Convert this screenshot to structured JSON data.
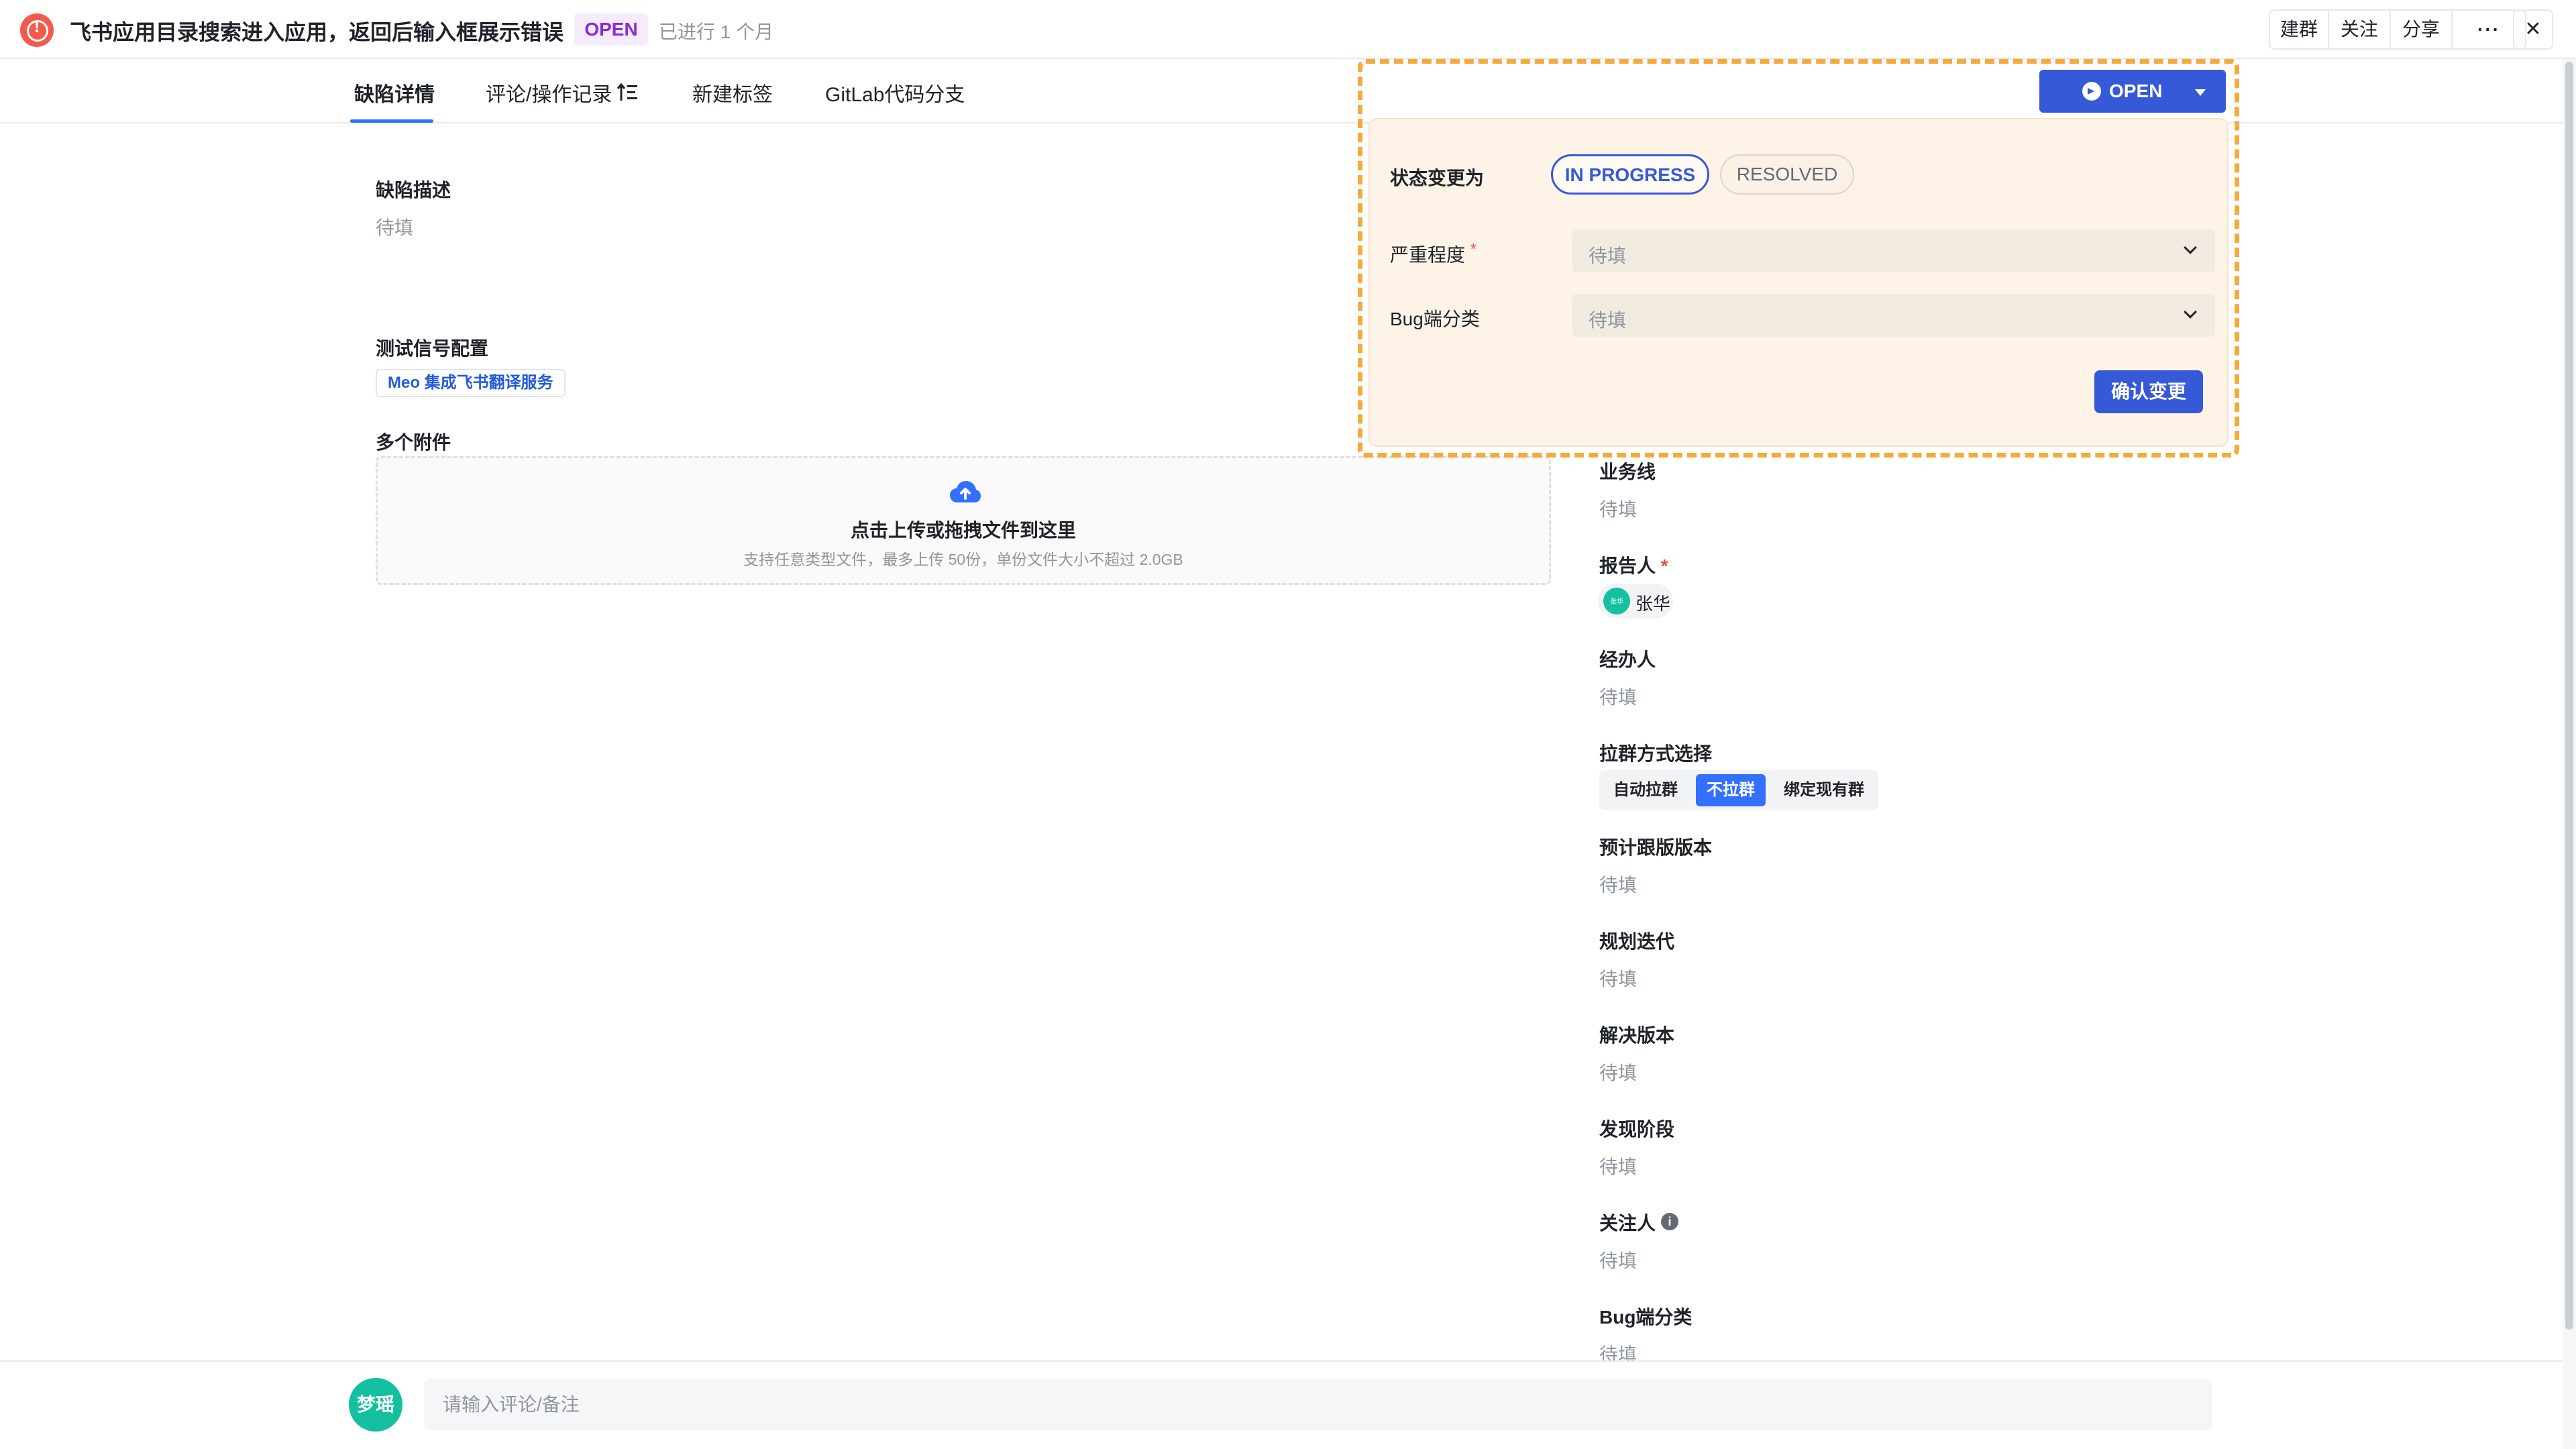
{
  "header": {
    "title": "飞书应用目录搜索进入应用，返回后输入框展示错误",
    "status_badge": "OPEN",
    "duration": "已进行 1 个月",
    "actions": [
      "建群",
      "关注",
      "分享",
      "···"
    ],
    "close": "✕"
  },
  "tabs": [
    {
      "label": "缺陷详情",
      "active": true
    },
    {
      "label": "评论/操作记录",
      "active": false
    },
    {
      "label": "新建标签",
      "active": false
    },
    {
      "label": "GitLab代码分支",
      "active": false
    }
  ],
  "left": {
    "description_label": "缺陷描述",
    "description_value": "待填",
    "signal_label": "测试信号配置",
    "signal_tag": "Meo 集成飞书翻译服务",
    "attachments_label": "多个附件",
    "upload_main": "点击上传或拖拽文件到这里",
    "upload_sub": "支持任意类型文件，最多上传 50份，单份文件大小不超过 2.0GB"
  },
  "properties": {
    "business_line": {
      "label": "业务线",
      "value": "待填"
    },
    "reporter": {
      "label": "报告人",
      "required_mark": "*",
      "value": "张华"
    },
    "assignee": {
      "label": "经办人",
      "value": "待填"
    },
    "group_method": {
      "label": "拉群方式选择",
      "options": [
        "自动拉群",
        "不拉群",
        "绑定现有群"
      ],
      "selected": "不拉群"
    },
    "planned_version": {
      "label": "预计跟版版本",
      "value": "待填"
    },
    "planned_iteration": {
      "label": "规划迭代",
      "value": "待填"
    },
    "resolved_version": {
      "label": "解决版本",
      "value": "待填"
    },
    "found_stage": {
      "label": "发现阶段",
      "value": "待填"
    },
    "watchers": {
      "label": "关注人",
      "value": "待填",
      "info": "i"
    },
    "bug_category": {
      "label": "Bug端分类",
      "value": "待填"
    }
  },
  "status_popover": {
    "button_label": "OPEN",
    "change_to_label": "状态变更为",
    "options": [
      "IN PROGRESS",
      "RESOLVED"
    ],
    "selected": "IN PROGRESS",
    "severity_label": "严重程度",
    "severity_required": "*",
    "severity_value": "待填",
    "bug_category_label": "Bug端分类",
    "bug_category_value": "待填",
    "confirm_label": "确认变更"
  },
  "footer": {
    "avatar_text": "梦瑶",
    "comment_placeholder": "请输入评论/备注"
  },
  "colors": {
    "accent": "#3370ff",
    "status_button": "#3659d7",
    "badge_bg": "#f5ebfe",
    "badge_text": "#8a2bd5",
    "highlight_outline": "#f7a93a",
    "popover_bg": "#fdf3e7"
  }
}
